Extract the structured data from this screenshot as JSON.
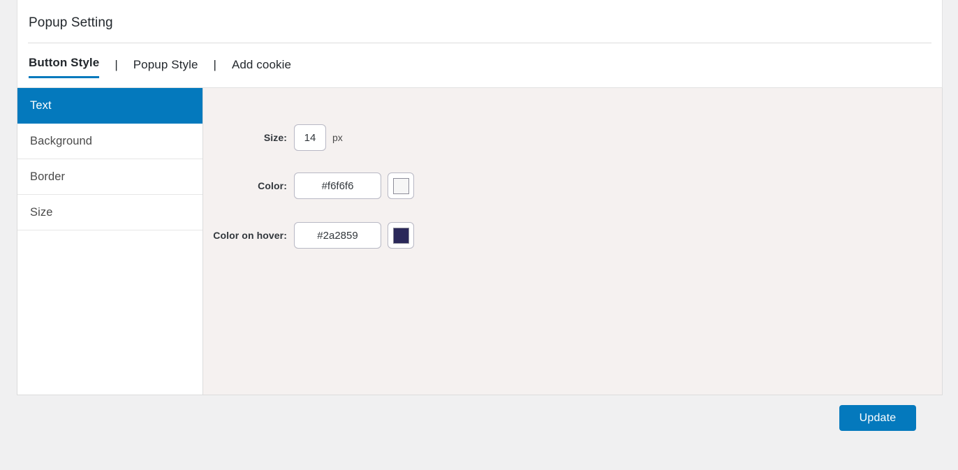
{
  "card": {
    "title": "Popup Setting"
  },
  "tabs": {
    "separator": "|",
    "items": [
      {
        "label": "Button Style",
        "active": true
      },
      {
        "label": "Popup Style",
        "active": false
      },
      {
        "label": "Add cookie",
        "active": false
      }
    ]
  },
  "sidebar": {
    "items": [
      {
        "label": "Text",
        "active": true
      },
      {
        "label": "Background",
        "active": false
      },
      {
        "label": "Border",
        "active": false
      },
      {
        "label": "Size",
        "active": false
      }
    ]
  },
  "form": {
    "size": {
      "label": "Size:",
      "value": "14",
      "unit": "px"
    },
    "color": {
      "label": "Color:",
      "value": "#f6f6f6",
      "swatch": "#f6f6f6",
      "swatch_icon": "color-swatch-icon"
    },
    "color_on_hover": {
      "label": "Color on hover:",
      "value": "#2a2859",
      "swatch": "#2a2859",
      "swatch_icon": "color-swatch-icon"
    }
  },
  "footer": {
    "update_label": "Update"
  },
  "colors": {
    "accent_blue": "#0479bd",
    "page_background": "#f0f0f1",
    "panel_background": "#f5f1f0",
    "card_background": "#ffffff",
    "text_dark": "#32373c"
  }
}
